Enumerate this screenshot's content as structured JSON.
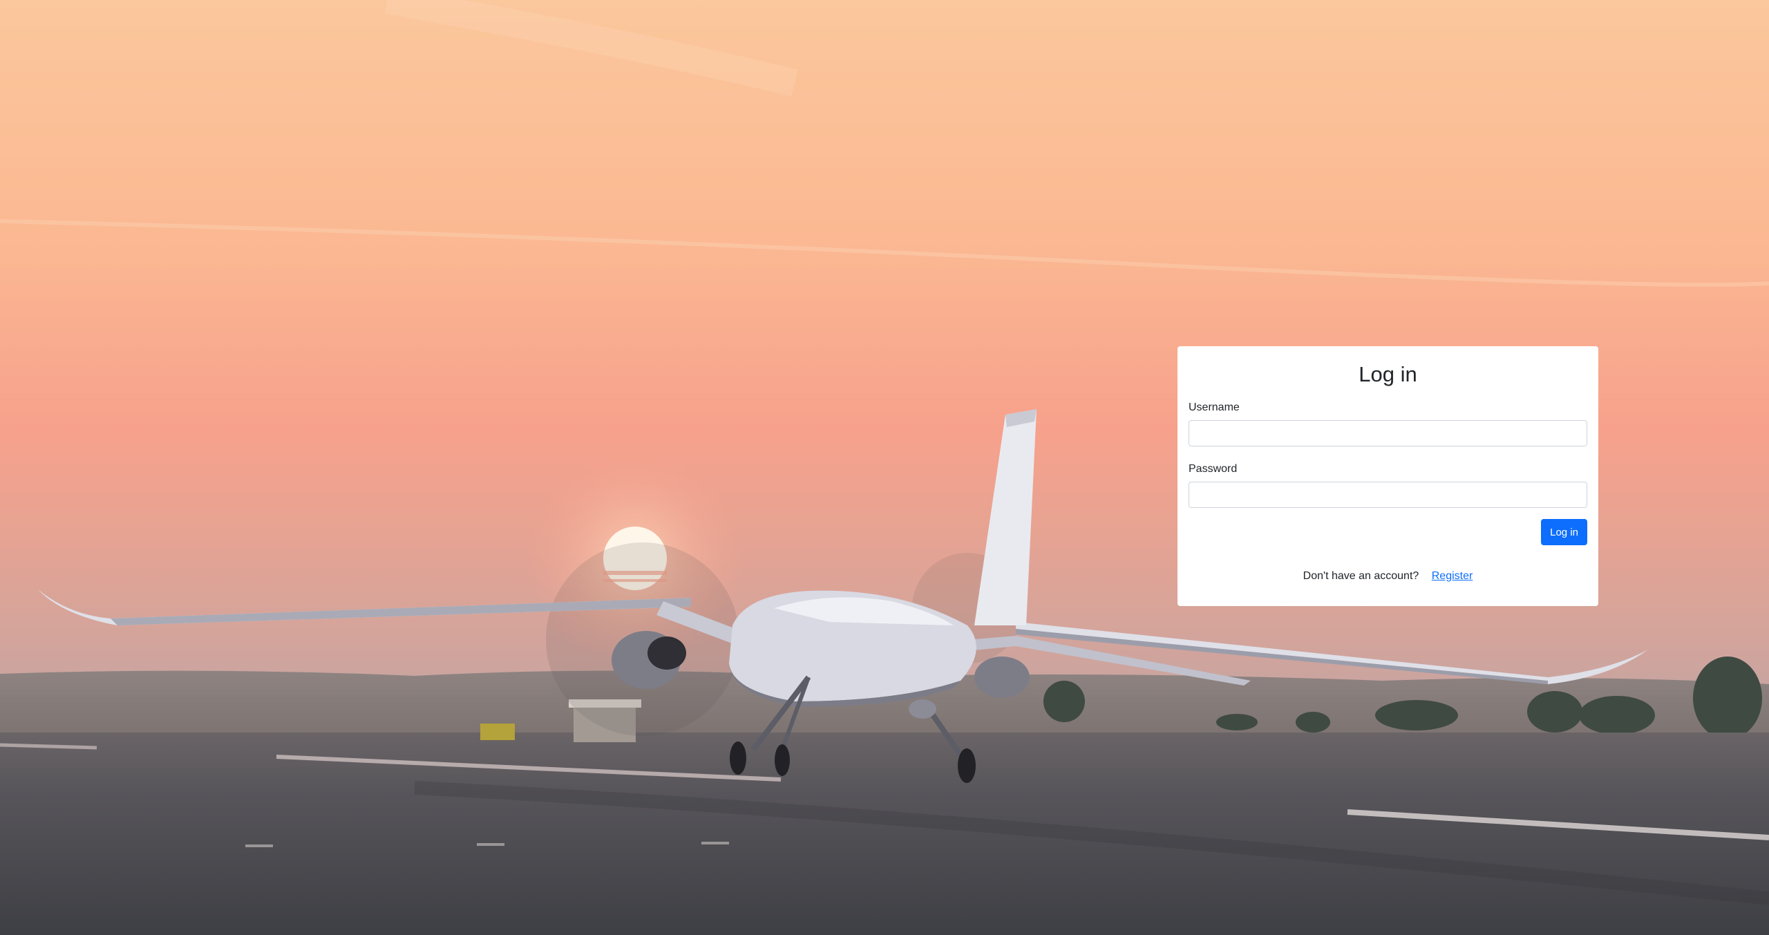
{
  "background": {
    "image_name": "uav-aircraft-on-runway-at-sunset",
    "sky_top": "#fbc49a",
    "sky_mid": "#f7a88e",
    "ground": "#4d4d51"
  },
  "login": {
    "title": "Log in",
    "username_label": "Username",
    "username_value": "",
    "password_label": "Password",
    "password_value": "",
    "submit_label": "Log in",
    "register_prompt": "Don't have an account?",
    "register_link": "Register"
  },
  "colors": {
    "primary": "#0d6efd",
    "card_bg": "#ffffff"
  }
}
